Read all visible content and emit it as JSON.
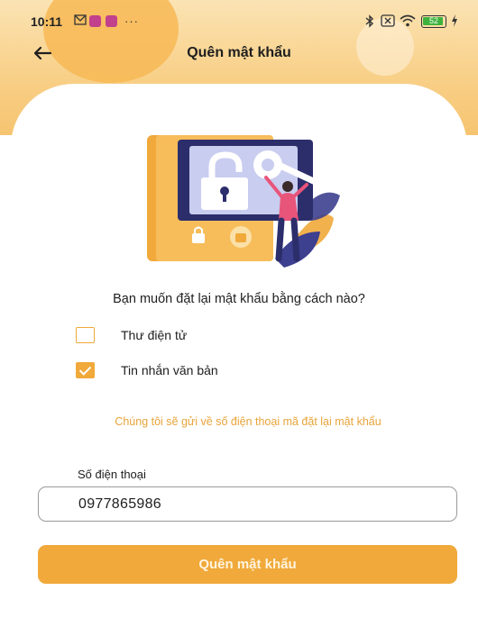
{
  "status_bar": {
    "time": "10:11",
    "icons": [
      "mail-icon",
      "app-icon",
      "app-icon",
      "more-icon",
      "bluetooth-icon",
      "no-sim-icon",
      "wifi-icon",
      "battery-icon"
    ],
    "more": "···",
    "battery_level": "52"
  },
  "header": {
    "title": "Quên mật khẩu",
    "back_icon": "arrow-left-icon"
  },
  "illustration": {
    "icon": "padlock-key-illustration"
  },
  "form": {
    "question": "Bạn muốn đặt lại mật khẩu bằng cách nào?",
    "options": [
      {
        "label": "Thư điện tử",
        "checked": false
      },
      {
        "label": "Tin nhắn văn bản",
        "checked": true
      }
    ],
    "info_text": "Chúng tôi sẽ gửi về số điện thoại mã đặt lại mật khẩu",
    "phone_label": "Số điện thoại",
    "phone_value": "0977865986",
    "submit_label": "Quên mật khẩu"
  },
  "colors": {
    "accent": "#f0a93a",
    "header_bg": "#f8cf86",
    "info_text": "#e8a43a"
  }
}
